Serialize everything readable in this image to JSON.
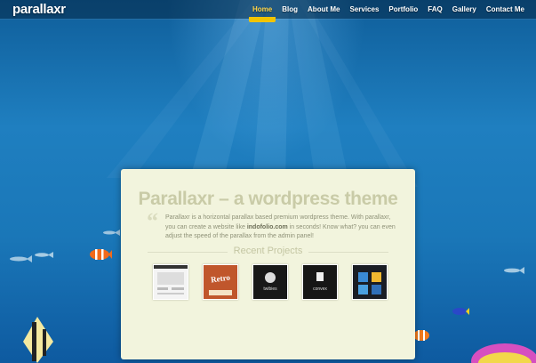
{
  "header": {
    "logo": "parallaxr",
    "nav": [
      {
        "label": "Home",
        "active": true
      },
      {
        "label": "Blog",
        "active": false
      },
      {
        "label": "About Me",
        "active": false
      },
      {
        "label": "Services",
        "active": false
      },
      {
        "label": "Portfolio",
        "active": false
      },
      {
        "label": "FAQ",
        "active": false
      },
      {
        "label": "Gallery",
        "active": false
      },
      {
        "label": "Contact Me",
        "active": false
      }
    ]
  },
  "card": {
    "title": "Parallaxr – a wordpress theme",
    "quote_mark": "“",
    "desc_before": "Parallaxr is a horizontal parallax based premium wordpress theme. With parallaxr, you can create a website like ",
    "desc_link": "indofolio.com",
    "desc_after": " in seconds! Know what? you can even adjust the speed of the parallax from the admin panel!",
    "recent_title": "Recent Projects",
    "projects": [
      {
        "label": ""
      },
      {
        "label": "Retro"
      },
      {
        "label": "twibies"
      },
      {
        "label": "convex"
      },
      {
        "label": ""
      }
    ]
  },
  "colors": {
    "accent": "#f2c400",
    "ocean_top": "#0f5e9a",
    "ocean_bottom": "#0e5aa0",
    "card_bg": "#f2f4dd"
  }
}
